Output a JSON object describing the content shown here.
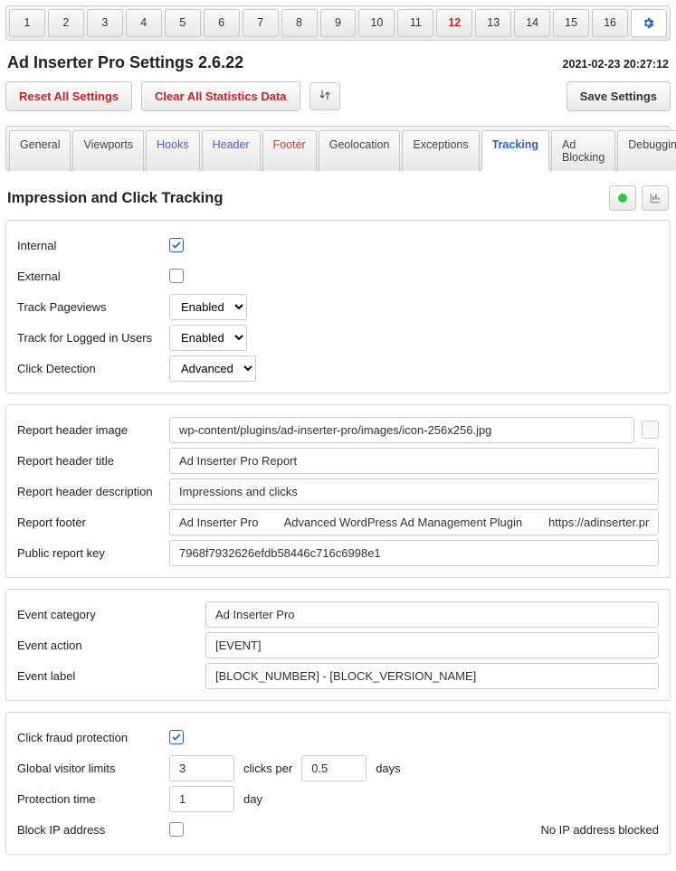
{
  "blockTabs": [
    "1",
    "2",
    "3",
    "4",
    "5",
    "6",
    "7",
    "8",
    "9",
    "10",
    "11",
    "12",
    "13",
    "14",
    "15",
    "16"
  ],
  "highlightTab": "12",
  "title": "Ad Inserter Pro Settings 2.6.22",
  "timestamp": "2021-02-23 20:27:12",
  "buttons": {
    "reset": "Reset All Settings",
    "clearStats": "Clear All Statistics Data",
    "save": "Save Settings"
  },
  "subTabs": [
    {
      "label": "General",
      "style": "pill"
    },
    {
      "label": "Viewports",
      "style": "pill"
    },
    {
      "label": "Hooks",
      "style": "blue"
    },
    {
      "label": "Header",
      "style": "blue"
    },
    {
      "label": "Footer",
      "style": "red"
    },
    {
      "label": "Geolocation",
      "style": "pill"
    },
    {
      "label": "Exceptions",
      "style": "pill"
    },
    {
      "label": "Tracking",
      "style": "active"
    },
    {
      "label": "Ad Blocking",
      "style": "pill"
    },
    {
      "label": "Debugging",
      "style": "pill"
    }
  ],
  "sectionTitle": "Impression and Click Tracking",
  "tracking": {
    "internalLabel": "Internal",
    "internalChecked": true,
    "externalLabel": "External",
    "externalChecked": false,
    "pageviewsLabel": "Track Pageviews",
    "pageviewsValue": "Enabled",
    "loggedInLabel": "Track for Logged in Users",
    "loggedInValue": "Enabled",
    "clickDetectionLabel": "Click Detection",
    "clickDetectionValue": "Advanced"
  },
  "report": {
    "imageLabel": "Report header image",
    "imageValue": "wp-content/plugins/ad-inserter-pro/images/icon-256x256.jpg",
    "titleLabel": "Report header title",
    "titleValue": "Ad Inserter Pro Report",
    "descLabel": "Report header description",
    "descValue": "Impressions and clicks",
    "footerLabel": "Report footer",
    "footerValue": "Ad Inserter Pro        Advanced WordPress Ad Management Plugin        https://adinserter.pro/",
    "keyLabel": "Public report key",
    "keyValue": "7968f7932626efdb58446c716c6998e1"
  },
  "events": {
    "categoryLabel": "Event category",
    "categoryValue": "Ad Inserter Pro",
    "actionLabel": "Event action",
    "actionValue": "[EVENT]",
    "labelLabel": "Event label",
    "labelValue": "[BLOCK_NUMBER] - [BLOCK_VERSION_NAME]"
  },
  "fraud": {
    "protectionLabel": "Click fraud protection",
    "protectionChecked": true,
    "limitsLabel": "Global visitor limits",
    "limitsClicks": "3",
    "limitsClicksPer": "clicks per",
    "limitsDays": "0.5",
    "limitsDaysWord": "days",
    "protTimeLabel": "Protection time",
    "protTimeValue": "1",
    "protTimeWord": "day",
    "blockIpLabel": "Block IP address",
    "blockIpChecked": false,
    "blockIpStatus": "No IP address blocked"
  }
}
